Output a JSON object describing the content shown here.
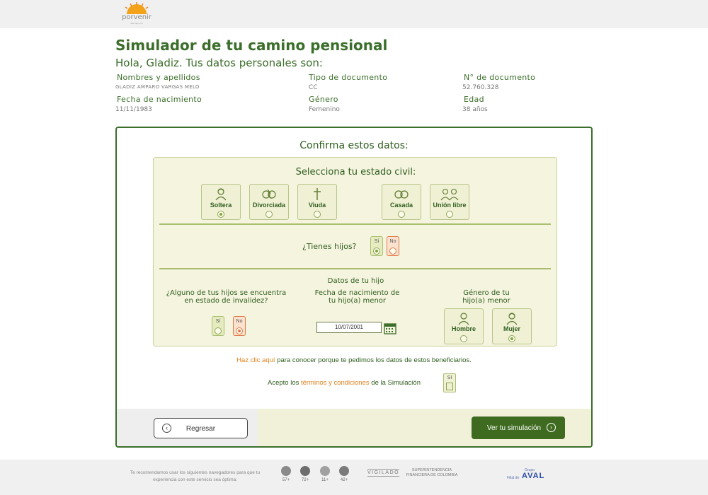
{
  "header": {
    "logo_word": "porvenir",
    "logo_tagline": "sólo hay uno"
  },
  "page": {
    "title": "Simulador de tu camino pensional",
    "greeting": "Hola, Gladiz. Tus datos personales son:"
  },
  "personal": {
    "name_label": "Nombres y apellidos",
    "name_value": "GLADIZ AMPARO VARGAS MELO",
    "doc_type_label": "Tipo de documento",
    "doc_type_value": "CC",
    "doc_num_label": "N° de documento",
    "doc_num_value": "52.760.328",
    "birth_label": "Fecha de nacimiento",
    "birth_value": "11/11/1983",
    "gender_label": "Género",
    "gender_value": "Femenino",
    "age_label": "Edad",
    "age_value": "38 años"
  },
  "form": {
    "confirm_title": "Confirma estos datos:",
    "civil_title": "Selecciona tu estado civil:",
    "civil_options": [
      {
        "label": "Soltera",
        "icon": "woman-icon",
        "selected": true
      },
      {
        "label": "Divorciada",
        "icon": "broken-rings-icon",
        "selected": false
      },
      {
        "label": "Viuda",
        "icon": "cross-icon",
        "selected": false
      },
      {
        "label": "Casada",
        "icon": "rings-icon",
        "selected": false
      },
      {
        "label": "Unión libre",
        "icon": "couple-icon",
        "selected": false
      }
    ],
    "children_question": "¿Tienes hijos?",
    "yes_label": "Sí",
    "no_label": "No",
    "child_section_title": "Datos de tu hijo",
    "invalidity_question": "¿Alguno de tus hijos se encuentra en estado de invalidez?",
    "child_birth_label": "Fecha de nacimiento de tu hijo(a) menor",
    "child_birth_value": "10/07/2001",
    "child_gender_label": "Género de tu hijo(a) menor",
    "gender_options": [
      {
        "label": "Hombre",
        "icon": "man-icon",
        "selected": false
      },
      {
        "label": "Mujer",
        "icon": "woman-icon",
        "selected": true
      }
    ],
    "click_link": "Haz clic aquí",
    "click_rest": " para conocer porque te pedimos los datos de estos beneficiarios.",
    "accept_prefix": "Acepto los ",
    "accept_link": "términos y condiciones",
    "accept_suffix": " de la Simulación",
    "accept_yes": "Sí"
  },
  "actions": {
    "back_label": "Regresar",
    "next_label": "Ver tu simulación"
  },
  "footer": {
    "recommend_text": "Te recomendamos usar los siguientes navegadores para que tu experiencia con este servicio sea óptima:",
    "browsers": [
      {
        "name": "firefox-icon",
        "version": "57+"
      },
      {
        "name": "chrome-icon",
        "version": "72+"
      },
      {
        "name": "safari-icon",
        "version": "11+"
      },
      {
        "name": "edge-icon",
        "version": "42+"
      }
    ],
    "vigilado": "VIGILADO",
    "superfin": "SUPERINTENDENCIA FINANCIERA DE COLOMBIA",
    "aval_grupo": "Grupo",
    "aval_filial": "Filial de",
    "aval_brand": "AVAL"
  },
  "colors": {
    "primary_green": "#3b6e2a",
    "button_green": "#3e6b1f",
    "accent_orange": "#e2841f",
    "panel_bg": "#f5f4df"
  }
}
